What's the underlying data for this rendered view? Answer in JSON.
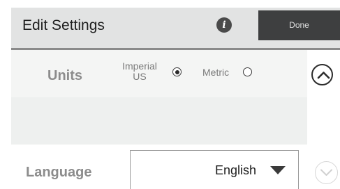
{
  "header": {
    "title": "Edit Settings",
    "info_icon": "info-icon",
    "done_label": "Done"
  },
  "units": {
    "label": "Units",
    "options": [
      {
        "label_line1": "Imperial",
        "label_line2": "US",
        "selected": true
      },
      {
        "label": "Metric",
        "selected": false
      }
    ],
    "collapse_icon": "chevron-up-icon"
  },
  "language": {
    "label": "Language",
    "value": "English",
    "dropdown_icon": "caret-down-icon",
    "expand_icon": "chevron-down-icon"
  },
  "colors": {
    "header_bg": "#e2e3e3",
    "done_bg": "#3e3f40",
    "panel_bg": "#eef0ef",
    "muted_text": "#8c8c8c"
  }
}
